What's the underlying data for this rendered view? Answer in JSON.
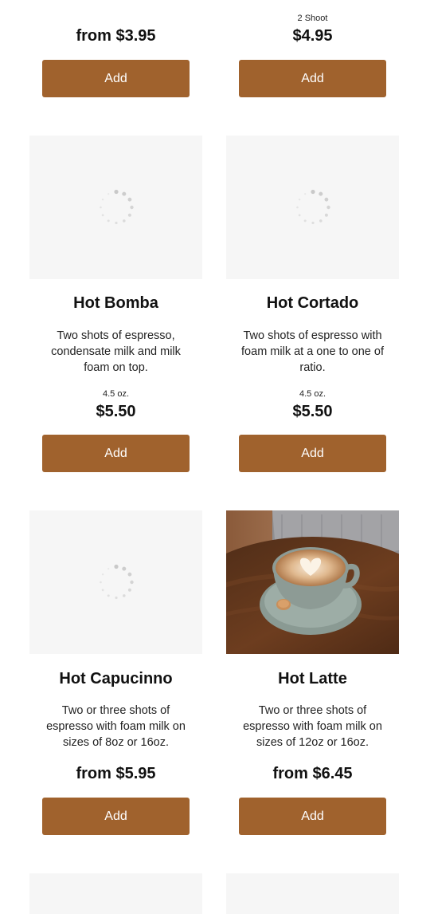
{
  "colors": {
    "button_bg": "#a0622d",
    "placeholder_bg": "#f6f6f6"
  },
  "row1": {
    "left": {
      "price": "from $3.95",
      "add_label": "Add"
    },
    "right": {
      "size": "2 Shoot",
      "price": "$4.95",
      "add_label": "Add"
    }
  },
  "row2": {
    "left": {
      "image": "loading-spinner-icon",
      "title": "Hot Bomba",
      "desc_lines": [
        "Two shots of espresso,",
        "condensate milk and milk",
        "foam on top."
      ],
      "size": "4.5 oz.",
      "price": "$5.50",
      "add_label": "Add"
    },
    "right": {
      "image": "loading-spinner-icon",
      "title": "Hot Cortado",
      "desc_lines": [
        "Two shots of espresso with",
        "foam milk at a one to one of",
        "ratio."
      ],
      "size": "4.5 oz.",
      "price": "$5.50",
      "add_label": "Add"
    }
  },
  "row3": {
    "left": {
      "image": "loading-spinner-icon",
      "title": "Hot Capucinno",
      "desc_lines": [
        "Two or three shots of",
        "espresso with foam milk on",
        "sizes of 8oz or 16oz."
      ],
      "price": "from $5.95",
      "add_label": "Add"
    },
    "right": {
      "image": "latte-photo",
      "title": "Hot Latte",
      "desc_lines": [
        "Two or three shots of",
        "espresso with foam milk on",
        "sizes of 12oz or 16oz."
      ],
      "price": "from $6.45",
      "add_label": "Add"
    }
  }
}
